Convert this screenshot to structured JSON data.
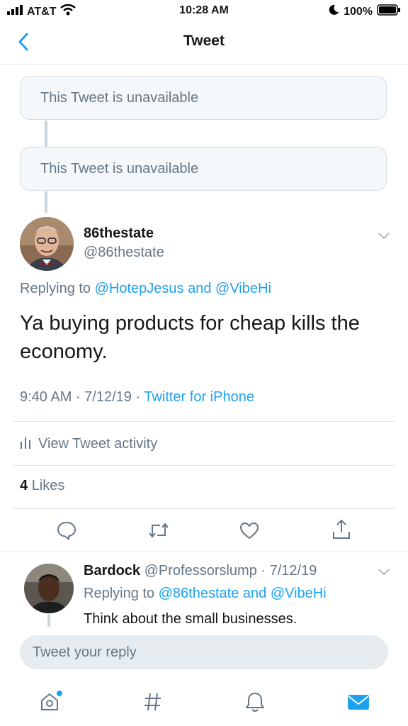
{
  "status_bar": {
    "carrier": "AT&T",
    "time": "10:28 AM",
    "battery": "100%"
  },
  "nav": {
    "title": "Tweet",
    "back_icon": "chevron-left-icon"
  },
  "unavailable": [
    {
      "text": "This Tweet is unavailable"
    },
    {
      "text": "This Tweet is unavailable"
    }
  ],
  "tweet": {
    "name": "86thestate",
    "handle": "@86thestate",
    "replying_prefix": "Replying to",
    "replying_to": "@HotepJesus and @VibeHi",
    "text_line1": "Ya buying products for cheap kills the",
    "text_line2": "economy.",
    "meta_time": "9:40 AM · 7/12/19 ·",
    "meta_source": "Twitter for iPhone",
    "activity_label": "View Tweet activity",
    "likes_count": "4",
    "likes_label": "Likes"
  },
  "reply": {
    "name": "Bardock",
    "handle_date": "@Professorslump · 7/12/19",
    "replying_prefix": "Replying to",
    "replying_to": "@86thestate and @VibeHi",
    "text": "Think about the small businesses."
  },
  "composer": {
    "placeholder": "Tweet your reply"
  },
  "colors": {
    "accent": "#1da1f2",
    "muted": "#657786",
    "border": "#e1e8ed"
  }
}
